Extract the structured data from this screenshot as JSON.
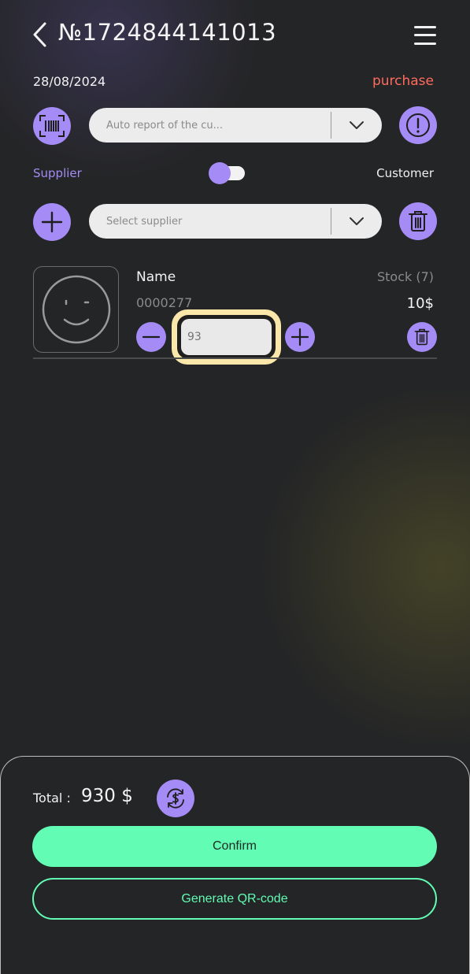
{
  "header": {
    "title": "№1724844141013",
    "date": "28/08/2024",
    "status": "purchase"
  },
  "report_select": {
    "value": "Auto report of the cu..."
  },
  "party_toggle": {
    "left_label": "Supplier",
    "right_label": "Customer",
    "selected": "Supplier"
  },
  "supplier_select": {
    "placeholder": "Select supplier"
  },
  "product": {
    "name": "Name",
    "code": "0000277",
    "stock": "Stock (7)",
    "price": "10$",
    "quantity": "93"
  },
  "footer": {
    "total_label": "Total :",
    "total_value": "930 $",
    "confirm_label": "Confirm",
    "qr_label": "Generate QR-code"
  },
  "colors": {
    "accent": "#a48bf5",
    "primary_action": "#62fcb4",
    "status": "#ff6b5e",
    "highlight": "#fbe7a9",
    "background": "#242526"
  },
  "icons": [
    "back-arrow-icon",
    "menu-icon",
    "barcode-icon",
    "chevron-down-icon",
    "info-icon",
    "plus-icon",
    "trash-icon",
    "smiley-icon",
    "minus-icon",
    "refresh-currency-icon"
  ]
}
